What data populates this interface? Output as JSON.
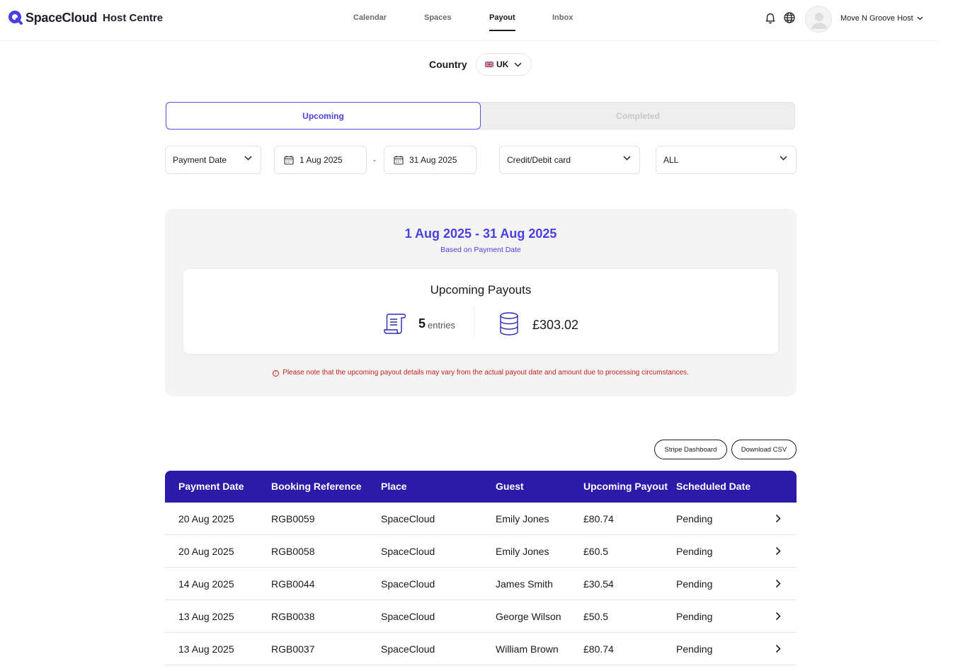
{
  "header": {
    "logo_text": "SpaceCloud",
    "logo_sub": "Host Centre",
    "nav": [
      {
        "label": "Calendar"
      },
      {
        "label": "Spaces"
      },
      {
        "label": "Payout"
      },
      {
        "label": "Inbox"
      }
    ],
    "active_nav": "Payout",
    "user_name": "Move N Groove Host"
  },
  "country": {
    "label": "Country",
    "value": "UK"
  },
  "tabs": {
    "upcoming": "Upcoming",
    "completed": "Completed",
    "active": "Upcoming"
  },
  "filters": {
    "date_type": "Payment Date",
    "start_date": "1 Aug 2025",
    "separator": "-",
    "end_date": "31 Aug 2025",
    "payment_method": "Credit/Debit card",
    "status": "ALL"
  },
  "summary": {
    "range": "1 Aug 2025 - 31 Aug 2025",
    "basis": "Based on Payment Date",
    "card_title": "Upcoming Payouts",
    "entries_count": "5",
    "entries_word": "entries",
    "amount": "£303.02",
    "notice": "Please note that the upcoming payout details may vary from the actual payout date and amount due to processing circumstances."
  },
  "actions": {
    "stripe": "Stripe Dashboard",
    "csv": "Download CSV"
  },
  "table": {
    "columns": [
      "Payment Date",
      "Booking Reference",
      "Place",
      "Guest",
      "Upcoming Payout",
      "Scheduled Date"
    ],
    "rows": [
      [
        "20 Aug 2025",
        "RGB0059",
        "SpaceCloud",
        "Emily Jones",
        "£80.74",
        "Pending"
      ],
      [
        "20 Aug 2025",
        "RGB0058",
        "SpaceCloud",
        "Emily Jones",
        "£60.5",
        "Pending"
      ],
      [
        "14 Aug 2025",
        "RGB0044",
        "SpaceCloud",
        "James Smith",
        "£30.54",
        "Pending"
      ],
      [
        "13 Aug 2025",
        "RGB0038",
        "SpaceCloud",
        "George Wilson",
        "£50.5",
        "Pending"
      ],
      [
        "13 Aug 2025",
        "RGB0037",
        "SpaceCloud",
        "William Brown",
        "£80.74",
        "Pending"
      ]
    ]
  },
  "colors": {
    "accent": "#4a3fe0",
    "table_header": "#2b1ba8",
    "warning": "#c42020"
  },
  "icons": [
    "logo-icon",
    "bell-icon",
    "globe-icon",
    "avatar-icon",
    "chevron-down-icon",
    "calendar-icon",
    "receipt-icon",
    "database-icon",
    "info-icon",
    "chevron-right-icon"
  ]
}
